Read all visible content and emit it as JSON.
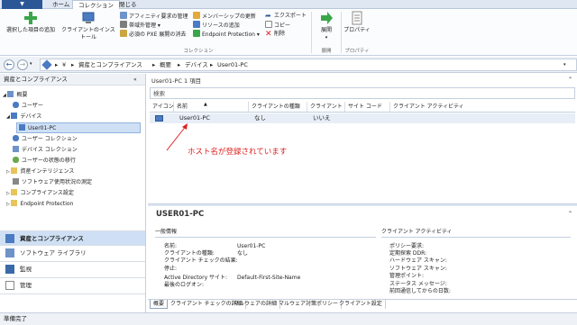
{
  "menu": {
    "tabs": [
      "ホーム",
      "コレクション",
      "閉じる"
    ]
  },
  "ribbon": {
    "big_buttons": [
      "選択した項目の追加",
      "クライアントのインストール",
      "展開",
      "プロパティ"
    ],
    "small_col1": [
      "アフィニティ要求の管理",
      "帯域外管理",
      "必須の PXE 展開の消去"
    ],
    "small_col2": [
      "メンバーシップの更新",
      "リソースの追加",
      "Endpoint Protection"
    ],
    "small_col3": [
      "エクスポート",
      "コピー",
      "削除"
    ],
    "groups": [
      "コレクション",
      "展開",
      "プロパティ"
    ]
  },
  "address": {
    "crumbs": [
      "¥",
      "資産とコンプライアンス",
      "概要",
      "デバイス",
      "User01-PC"
    ]
  },
  "nav": {
    "header": "資産とコンプライアンス",
    "items": [
      "概要",
      "ユーザー",
      "デバイス",
      "User01-PC",
      "ユーザー コレクション",
      "デバイス コレクション",
      "ユーザーの状態の移行",
      "資産インテリジェンス",
      "ソフトウェア使用状況の測定",
      "コンプライアンス設定",
      "Endpoint Protection"
    ],
    "workspaces": [
      "資産とコンプライアンス",
      "ソフトウェア ライブラリ",
      "監視",
      "管理"
    ]
  },
  "main": {
    "title": "User01-PC 1 項目",
    "search_placeholder": "検索",
    "columns": [
      "アイコン",
      "名前",
      "クライアントの種類",
      "クライアント",
      "サイト コード",
      "クライアント アクティビティ"
    ],
    "row": {
      "name": "User01-PC",
      "client_type": "なし",
      "client": "いいえ"
    },
    "annotation": "ホスト名が登録されています"
  },
  "details": {
    "title": "USER01-PC",
    "general_header": "一般情報",
    "labels": [
      "名前:",
      "クライアントの種類:",
      "クライアント チェックの結果:",
      "停止:",
      "Active Directory サイト:",
      "最後のログオン:"
    ],
    "values": [
      "User01-PC",
      "なし",
      "",
      "",
      "Default-First-Site-Name",
      ""
    ],
    "activity_header": "クライアント アクティビティ",
    "activity_labels": [
      "ポリシー要求:",
      "定期探索 DDR:",
      "ハードウェア スキャン:",
      "ソフトウェア スキャン:",
      "管理ポイント:",
      "ステータス メッセージ:",
      "前回通信してからの日数:"
    ],
    "tabs": [
      "概要",
      "クライアント チェックの詳細",
      "マルウェアの詳細",
      "マルウェア対策ポリシー",
      "クライアント設定"
    ]
  },
  "status_bar": "準備完了",
  "colors": {
    "accent": "#2b5797",
    "annotation": "#e02020",
    "selection": "#cfe0f5"
  }
}
